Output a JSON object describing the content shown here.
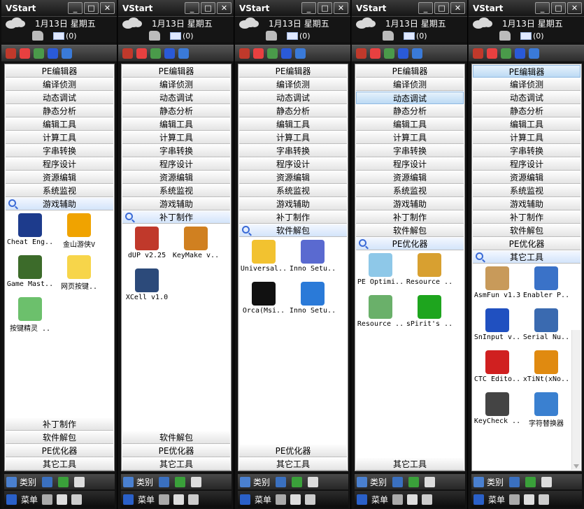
{
  "windows": [
    {
      "title": "VStart",
      "date": "1月13日 星期五",
      "mail_count": "(0)",
      "categories": [
        "PE编辑器",
        "编译侦测",
        "动态调试",
        "静态分析",
        "编辑工具",
        "计算工具",
        "字串转换",
        "程序设计",
        "资源编辑",
        "系统监视"
      ],
      "open_category": "游戏辅助",
      "items": [
        {
          "label": "Cheat Eng..",
          "icon": "cheat-engine-icon",
          "color": "#1d3b8c"
        },
        {
          "label": "金山游侠V",
          "icon": "jinshan-youxia-icon",
          "color": "#f0a300"
        },
        {
          "label": "Game Mast..",
          "icon": "game-master-icon",
          "color": "#3c6b2a"
        },
        {
          "label": "网页按键..",
          "icon": "web-keypress-icon",
          "color": "#f7d54a"
        },
        {
          "label": "按键精灵 ..",
          "icon": "key-wizard-icon",
          "color": "#6cc06c"
        }
      ],
      "bottom_categories": [
        "补丁制作",
        "软件解包",
        "PE优化器",
        "其它工具"
      ],
      "highlight": null
    },
    {
      "title": "VStart",
      "date": "1月13日 星期五",
      "mail_count": "(0)",
      "categories": [
        "PE编辑器",
        "编译侦测",
        "动态调试",
        "静态分析",
        "编辑工具",
        "计算工具",
        "字串转换",
        "程序设计",
        "资源编辑",
        "系统监视",
        "游戏辅助"
      ],
      "open_category": "补丁制作",
      "items": [
        {
          "label": "dUP v2.25",
          "icon": "dup-icon",
          "color": "#c0392b"
        },
        {
          "label": "KeyMake v..",
          "icon": "keymake-icon",
          "color": "#d08020"
        },
        {
          "label": "XCell v1.0",
          "icon": "xcell-icon",
          "color": "#2c4a7a"
        }
      ],
      "bottom_categories": [
        "软件解包",
        "PE优化器",
        "其它工具"
      ],
      "highlight": null
    },
    {
      "title": "VStart",
      "date": "1月13日 星期五",
      "mail_count": "(0)",
      "categories": [
        "PE编辑器",
        "编译侦测",
        "动态调试",
        "静态分析",
        "编辑工具",
        "计算工具",
        "字串转换",
        "程序设计",
        "资源编辑",
        "系统监视",
        "游戏辅助",
        "补丁制作"
      ],
      "open_category": "软件解包",
      "items": [
        {
          "label": "Universal..",
          "icon": "universal-extractor-icon",
          "color": "#f2c230"
        },
        {
          "label": "Inno Setu..",
          "icon": "inno-setup-icon",
          "color": "#5a6ad0"
        },
        {
          "label": "Orca(Msi..",
          "icon": "orca-icon",
          "color": "#111111"
        },
        {
          "label": "Inno Setu..",
          "icon": "inno-setup-unpacker-icon",
          "color": "#2a7ad8"
        }
      ],
      "bottom_categories": [
        "PE优化器",
        "其它工具"
      ],
      "highlight": null
    },
    {
      "title": "VStart",
      "date": "1月13日 星期五",
      "mail_count": "(0)",
      "categories": [
        "PE编辑器",
        "编译侦测",
        "动态调试",
        "静态分析",
        "编辑工具",
        "计算工具",
        "字串转换",
        "程序设计",
        "资源编辑",
        "系统监视",
        "游戏辅助",
        "补丁制作",
        "软件解包"
      ],
      "open_category": "PE优化器",
      "items": [
        {
          "label": "PE Optimi..",
          "icon": "pe-optimizer-icon",
          "color": "#8ec8e8"
        },
        {
          "label": "Resource ..",
          "icon": "resource-builder-icon",
          "color": "#d8a030"
        },
        {
          "label": "Resource ..",
          "icon": "resource-tuner-icon",
          "color": "#6ab06a"
        },
        {
          "label": "sPirit's ..",
          "icon": "spirit-icon",
          "color": "#1ea51e"
        }
      ],
      "bottom_categories": [
        "其它工具"
      ],
      "highlight": "动态调试"
    },
    {
      "title": "VStart",
      "date": "1月13日 星期五",
      "mail_count": "(0)",
      "categories": [
        "PE编辑器",
        "编译侦测",
        "动态调试",
        "静态分析",
        "编辑工具",
        "计算工具",
        "字串转换",
        "程序设计",
        "资源编辑",
        "系统监视",
        "游戏辅助",
        "补丁制作",
        "软件解包",
        "PE优化器"
      ],
      "open_category": "其它工具",
      "items": [
        {
          "label": "AsmFun v1.3",
          "icon": "asmfun-icon",
          "color": "#c89a5a"
        },
        {
          "label": "Enabler P..",
          "icon": "enabler-icon",
          "color": "#3a72c8"
        },
        {
          "label": "SnInput v..",
          "icon": "sninput-icon",
          "color": "#2050c0"
        },
        {
          "label": "Serial Nu..",
          "icon": "serial-number-icon",
          "color": "#3a6ab0"
        },
        {
          "label": "CTC Edito..",
          "icon": "ctc-editor-icon",
          "color": "#d02020"
        },
        {
          "label": "xTiNt(xNo..",
          "icon": "xtint-icon",
          "color": "#e08a10"
        },
        {
          "label": "KeyCheck ..",
          "icon": "keycheck-icon",
          "color": "#444444"
        },
        {
          "label": "字符替换器",
          "icon": "char-replacer-icon",
          "color": "#3a80d0"
        }
      ],
      "bottom_categories": [],
      "highlight": "PE编辑器"
    }
  ],
  "footer": {
    "categories_label": "类别",
    "menu_label": "菜单"
  },
  "window_buttons": {
    "minimize": "_",
    "restore": "□",
    "close": "✕"
  }
}
